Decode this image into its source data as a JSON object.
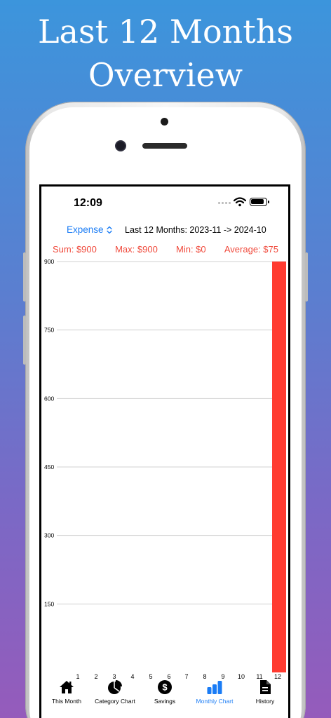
{
  "headline": {
    "line1": "Last 12 Months",
    "line2": "Overview"
  },
  "status_bar": {
    "time": "12:09"
  },
  "toolbar": {
    "type_picker_value": "Expense",
    "range_label": "Last 12 Months: 2023-11 -> 2024-10"
  },
  "stats": {
    "sum": "Sum: $900",
    "max": "Max: $900",
    "min": "Min: $0",
    "average": "Average: $75"
  },
  "chart_data": {
    "type": "bar",
    "categories": [
      "1",
      "2",
      "3",
      "4",
      "5",
      "6",
      "7",
      "8",
      "9",
      "10",
      "11",
      "12"
    ],
    "values": [
      0,
      0,
      0,
      0,
      0,
      0,
      0,
      0,
      0,
      0,
      0,
      900
    ],
    "y_ticks": [
      "150",
      "300",
      "450",
      "600",
      "750",
      "900"
    ],
    "ylim": [
      0,
      900
    ],
    "grid": true,
    "bar_color": "#ff3b30"
  },
  "tabs": [
    {
      "label": "This Month",
      "icon": "house-icon",
      "active": false
    },
    {
      "label": "Category Chart",
      "icon": "pie-chart-icon",
      "active": false
    },
    {
      "label": "Savings",
      "icon": "dollar-circle-icon",
      "active": false
    },
    {
      "label": "Monthly Chart",
      "icon": "bar-chart-icon",
      "active": true
    },
    {
      "label": "History",
      "icon": "document-icon",
      "active": false
    }
  ],
  "colors": {
    "accent": "#1a7cf5",
    "stats_red": "#f04a3c",
    "bar_red": "#ff3b30"
  }
}
